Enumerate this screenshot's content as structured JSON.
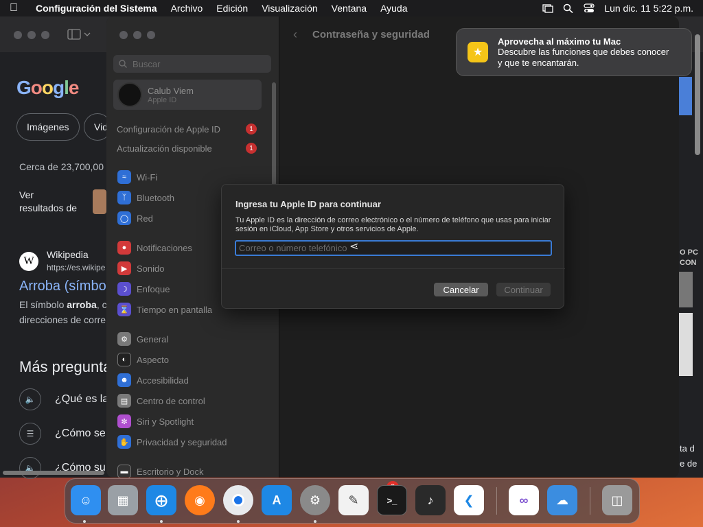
{
  "menubar": {
    "app_name": "Configuración del Sistema",
    "menus": [
      "Archivo",
      "Edición",
      "Visualización",
      "Ventana",
      "Ayuda"
    ],
    "clock": "Lun dic. 11  5:22 p.m.",
    "icons": [
      "apple-icon",
      "screen-mirror-icon",
      "spotlight-search-icon",
      "control-center-icon"
    ]
  },
  "browser": {
    "logo": "Google",
    "tabs": [
      "Imágenes",
      "Vid"
    ],
    "result_count": "Cerca de 23,700,00",
    "see_results_line1": "Ver",
    "see_results_line2": "resultados de",
    "wiki_name": "Wikipedia",
    "wiki_url": "https://es.wikipe",
    "result_title": "Arroba (símbo",
    "snippet_line1_prefix": "El símbolo ",
    "snippet_bold": "arroba",
    "snippet_line1_suffix": ", c",
    "snippet_line2": "direcciones de corre",
    "more_questions": "Más pregunta",
    "faq": [
      "¿Qué es la",
      "¿Cómo se",
      "¿Cómo su"
    ],
    "right_edge_text": [
      "O PC",
      "CON"
    ],
    "right_edge_bottom": [
      "ta d",
      "e de"
    ]
  },
  "settings": {
    "search_placeholder": "Buscar",
    "account_name": "Calub Viem",
    "account_sub": "Apple ID",
    "apple_id_config": "Configuración de Apple ID",
    "update_available": "Actualización disponible",
    "badge_count": "1",
    "items": [
      {
        "label": "Wi-Fi",
        "color": "#2f6fd6"
      },
      {
        "label": "Bluetooth",
        "color": "#2f6fd6"
      },
      {
        "label": "Red",
        "color": "#2f6fd6"
      },
      {
        "label": "Notificaciones",
        "color": "#d23a3a"
      },
      {
        "label": "Sonido",
        "color": "#d23a3a"
      },
      {
        "label": "Enfoque",
        "color": "#5b4fcf"
      },
      {
        "label": "Tiempo en pantalla",
        "color": "#5b4fcf"
      },
      {
        "label": "General",
        "color": "#7a7a7a"
      },
      {
        "label": "Aspecto",
        "color": "#222222"
      },
      {
        "label": "Accesibilidad",
        "color": "#2f6fd6"
      },
      {
        "label": "Centro de control",
        "color": "#7a7a7a"
      },
      {
        "label": "Siri y Spotlight",
        "color": "#b04fcf"
      },
      {
        "label": "Privacidad y seguridad",
        "color": "#2f6fd6"
      },
      {
        "label": "Escritorio y Dock",
        "color": "#333333"
      }
    ],
    "pane_title": "Contraseña y seguridad"
  },
  "notification": {
    "title": "Aprovecha al máximo tu Mac",
    "body_line1": "Descubre las funciones que debes conocer",
    "body_line2": "y que te encantarán."
  },
  "dialog": {
    "title": "Ingresa tu Apple ID para continuar",
    "description": "Tu Apple ID es la dirección de correo electrónico o el número de teléfono que usas para iniciar sesión en iCloud, App Store y otros servicios de Apple.",
    "input_placeholder": "Correo o número telefónico",
    "input_value": "",
    "cancel_label": "Cancelar",
    "continue_label": "Continuar"
  },
  "dock": {
    "apps": [
      {
        "name": "finder-icon",
        "color": "#2f8ff0"
      },
      {
        "name": "launchpad-icon",
        "color": "#9aa0a6"
      },
      {
        "name": "safari-icon",
        "color": "#1e88e5"
      },
      {
        "name": "firefox-icon",
        "color": "#ff7b1a"
      },
      {
        "name": "chrome-icon",
        "color": "#e8eaed"
      },
      {
        "name": "app-store-icon",
        "color": "#1e88e5"
      },
      {
        "name": "system-settings-icon",
        "color": "#8a8a8a"
      },
      {
        "name": "textedit-icon",
        "color": "#f2f2f2"
      },
      {
        "name": "terminal-icon",
        "color": "#1a1a1a"
      },
      {
        "name": "garageband-icon",
        "color": "#2a2a2a"
      },
      {
        "name": "vscode-icon",
        "color": "#ffffff"
      },
      {
        "name": "visual-studio-icon",
        "color": "#ffffff"
      },
      {
        "name": "weather-icon",
        "color": "#3b8de0"
      },
      {
        "name": "trash-icon",
        "color": "#9a9a9a"
      }
    ],
    "settings_badge": "2",
    "terminal_glyph": ">_"
  }
}
